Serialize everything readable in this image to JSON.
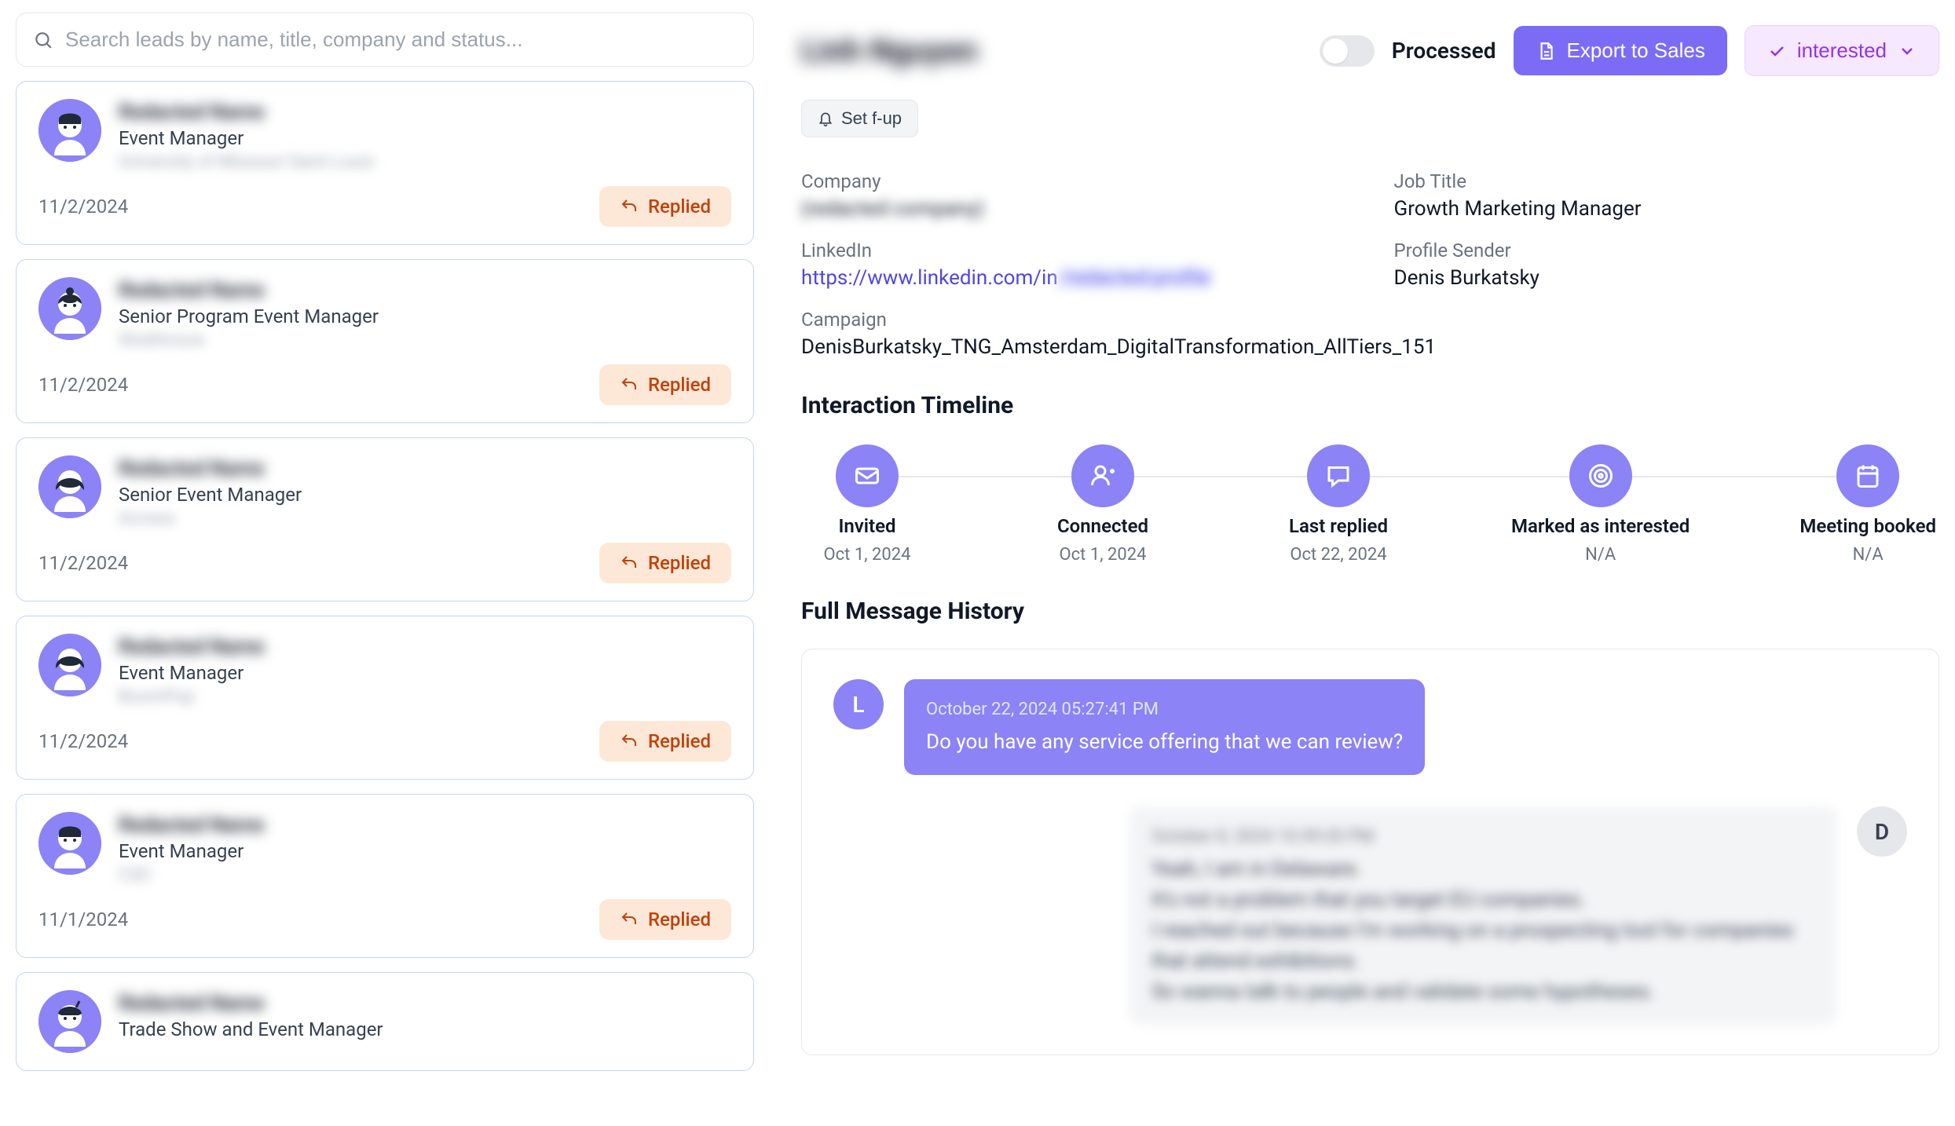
{
  "search": {
    "placeholder": "Search leads by name, title, company and status..."
  },
  "leads": [
    {
      "name": "Redacted Name",
      "title": "Event Manager",
      "company": "University of Missouri Saint Louis",
      "date": "11/2/2024",
      "status": "Replied",
      "avatar": "m1"
    },
    {
      "name": "Redacted Name",
      "title": "Senior Program Event Manager",
      "company": "Strathmore",
      "date": "11/2/2024",
      "status": "Replied",
      "avatar": "f1"
    },
    {
      "name": "Redacted Name",
      "title": "Senior Event Manager",
      "company": "Access",
      "date": "11/2/2024",
      "status": "Replied",
      "avatar": "f2"
    },
    {
      "name": "Redacted Name",
      "title": "Event Manager",
      "company": "BoomPop",
      "date": "11/2/2024",
      "status": "Replied",
      "avatar": "f2"
    },
    {
      "name": "Redacted Name",
      "title": "Event Manager",
      "company": "CSC",
      "date": "11/1/2024",
      "status": "Replied",
      "avatar": "m1"
    },
    {
      "name": "Redacted Name",
      "title": "Trade Show and Event Manager",
      "company": "",
      "date": "",
      "status": "",
      "avatar": "m2"
    }
  ],
  "detail": {
    "name": "Linh Nguyen",
    "processed_label": "Processed",
    "export_label": "Export to Sales",
    "interest_label": "interested",
    "followup_label": "Set f-up",
    "fields": {
      "company_label": "Company",
      "company_value": "(redacted company)",
      "jobtitle_label": "Job Title",
      "jobtitle_value": "Growth Marketing Manager",
      "linkedin_label": "LinkedIn",
      "linkedin_prefix": "https://www.linkedin.com/in",
      "linkedin_suffix": "/redacted-profile",
      "sender_label": "Profile Sender",
      "sender_value": "Denis Burkatsky",
      "campaign_label": "Campaign",
      "campaign_value": "DenisBurkatsky_TNG_Amsterdam_DigitalTransformation_AllTiers_151"
    }
  },
  "timeline": {
    "title": "Interaction Timeline",
    "steps": [
      {
        "label": "Invited",
        "date": "Oct 1, 2024",
        "icon": "mail"
      },
      {
        "label": "Connected",
        "date": "Oct 1, 2024",
        "icon": "user-plus"
      },
      {
        "label": "Last replied",
        "date": "Oct 22, 2024",
        "icon": "chat"
      },
      {
        "label": "Marked as interested",
        "date": "N/A",
        "icon": "target"
      },
      {
        "label": "Meeting booked",
        "date": "N/A",
        "icon": "calendar"
      }
    ]
  },
  "messages": {
    "title": "Full Message History",
    "lead_initial": "L",
    "sender_initial": "D",
    "items": [
      {
        "side": "lead",
        "timestamp": "October 22, 2024 05:27:41 PM",
        "text": "Do you have any service offering that we can review?"
      },
      {
        "side": "sender",
        "timestamp": "October 8, 2024 10:39:20 PM",
        "text": "Yeah, I am in Delaware.\nIt's not a problem that you target EU companies.\nI reached out because I'm working on a prospecting tool for companies that attend exhibitions.\nSo wanna talk to people and validate some hypotheses."
      }
    ]
  }
}
